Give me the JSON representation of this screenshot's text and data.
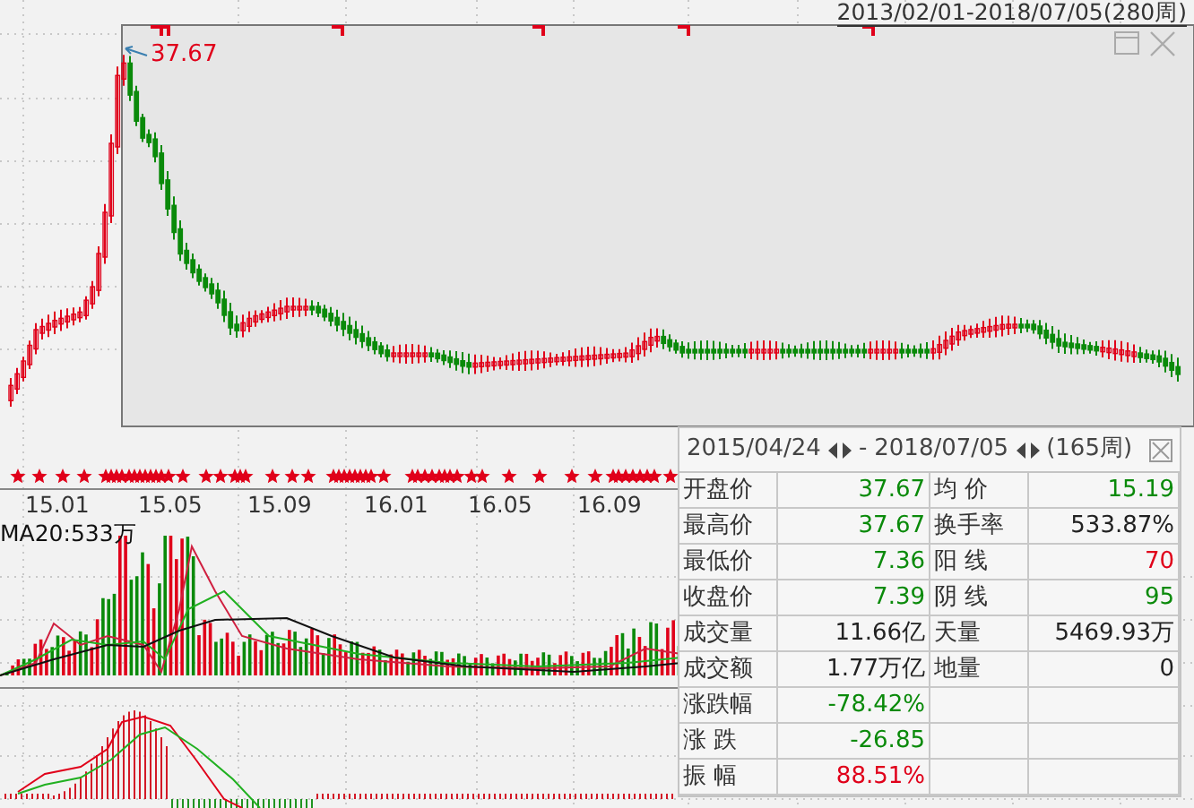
{
  "range_label": "2013/02/01-2018/07/05(280周)",
  "peak_label": "37.67",
  "x_axis": [
    "15.01",
    "15.05",
    "15.09",
    "16.01",
    "16.05",
    "16.09"
  ],
  "volume_label": "MA20:533万",
  "stats": {
    "start": "2015/04/24",
    "separator": "-",
    "end": "2018/07/05",
    "count": "(165周)",
    "rows": [
      {
        "label": "开盘价",
        "value": "37.67",
        "color": "#0a8a0a"
      },
      {
        "label": "最高价",
        "value": "37.67",
        "color": "#0a8a0a"
      },
      {
        "label": "最低价",
        "value": "7.36",
        "color": "#0a8a0a"
      },
      {
        "label": "收盘价",
        "value": "7.39",
        "color": "#0a8a0a"
      },
      {
        "label": "成交量",
        "value": "11.66亿",
        "color": "#222222"
      },
      {
        "label": "成交额",
        "value": "1.77万亿",
        "color": "#222222"
      },
      {
        "label": "涨跌幅",
        "value": "-78.42%",
        "color": "#0a8a0a"
      },
      {
        "label": "涨 跌",
        "value": "-26.85",
        "color": "#0a8a0a"
      },
      {
        "label": "振 幅",
        "value": "88.51%",
        "color": "#e0001a"
      }
    ],
    "rows_right": [
      {
        "label": "均 价",
        "value": "15.19",
        "color": "#0a8a0a"
      },
      {
        "label": "换手率",
        "value": "533.87%",
        "color": "#222222"
      },
      {
        "label": "阳 线",
        "value": "70",
        "color": "#e0001a"
      },
      {
        "label": "阴 线",
        "value": "95",
        "color": "#0a8a0a"
      },
      {
        "label": "天量",
        "value": "5469.93万",
        "color": "#222222"
      },
      {
        "label": "地量",
        "value": "0",
        "color": "#222222"
      }
    ]
  }
}
